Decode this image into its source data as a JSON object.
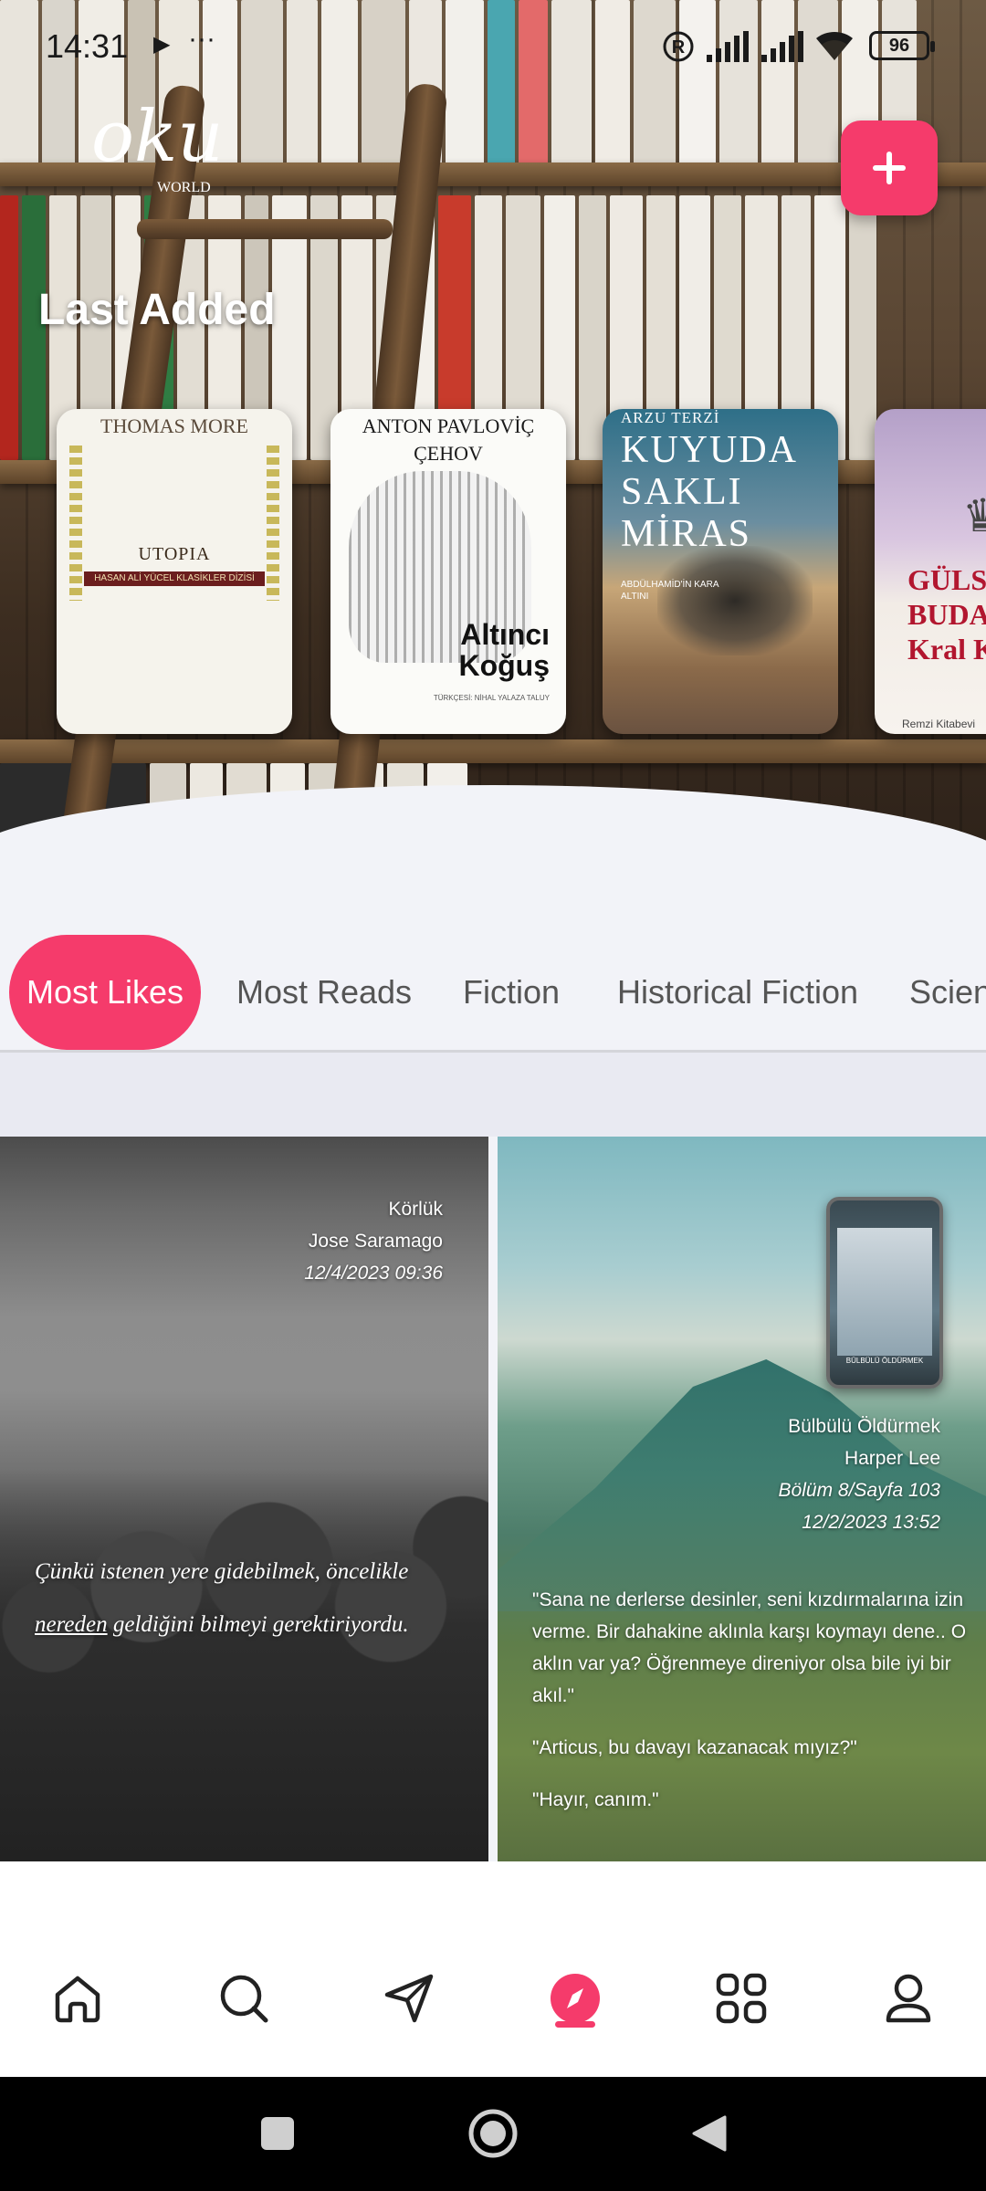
{
  "status_bar": {
    "time": "14:31",
    "battery": "96",
    "icons": [
      "play-icon",
      "more-dots-icon",
      "registered-icon",
      "signal-icon",
      "signal-icon",
      "wifi-icon",
      "battery-icon"
    ]
  },
  "header": {
    "logo_main": "oku",
    "logo_sub": "WORLD",
    "add_button_icon": "plus-icon"
  },
  "last_added": {
    "title": "Last Added",
    "books": [
      {
        "author": "THOMAS MORE",
        "title": "UTOPIA",
        "band": "HASAN ALİ YÜCEL KLASİKLER DİZİSİ"
      },
      {
        "author": "ANTON PAVLOVİÇ ÇEHOV",
        "title": "Altıncı Koğuş",
        "translator": "TÜRKÇESİ: NİHAL YALAZA TALUY"
      },
      {
        "author": "ARZU TERZİ",
        "title": "KUYUDA SAKLI MİRAS",
        "subtitle": "ABDÜLHAMİD'İN KARA ALTINI"
      },
      {
        "title": "GÜLSEREN BUDAYICI Kral Ka",
        "publisher": "Remzi Kitabevi"
      }
    ]
  },
  "tabs": [
    {
      "label": "Most Likes",
      "active": true
    },
    {
      "label": "Most Reads",
      "active": false
    },
    {
      "label": "Fiction",
      "active": false
    },
    {
      "label": "Historical Fiction",
      "active": false
    },
    {
      "label": "Scien",
      "active": false
    }
  ],
  "posts": [
    {
      "book": "Körlük",
      "author": "Jose Saramago",
      "date": "12/4/2023 09:36",
      "quote_before": "Çünkü istenen yere gidebilmek, öncelikle ",
      "quote_underlined": "nereden",
      "quote_after": " geldiğini bilmeyi gerektiriyordu."
    },
    {
      "book": "Bülbülü Öldürmek",
      "author": "Harper Lee",
      "chapter": "Bölüm 8/Sayfa 103",
      "date": "12/2/2023 13:52",
      "quote_lines": [
        "\"Sana ne derlerse desinler, seni kızdırmalarına izin verme. Bir dahakine aklınla karşı koymayı dene.. O aklın var ya? Öğrenmeye direniyor olsa bile iyi bir akıl.\"",
        "\"Articus, bu davayı kazanacak mıyız?\"",
        "\"Hayır, canım.\""
      ],
      "mini_cover_caption": "BÜLBÜLÜ ÖLDÜRMEK"
    }
  ],
  "bottom_nav": [
    {
      "icon": "home-icon",
      "active": false
    },
    {
      "icon": "search-icon",
      "active": false
    },
    {
      "icon": "send-icon",
      "active": false
    },
    {
      "icon": "explore-icon",
      "active": true
    },
    {
      "icon": "grid-icon",
      "active": false
    },
    {
      "icon": "profile-icon",
      "active": false
    }
  ],
  "system_nav": [
    "recents-square-icon",
    "home-circle-icon",
    "back-triangle-icon"
  ],
  "colors": {
    "accent": "#f53b6b",
    "background": "#f2f3f8",
    "nav_background": "#ffffff"
  }
}
